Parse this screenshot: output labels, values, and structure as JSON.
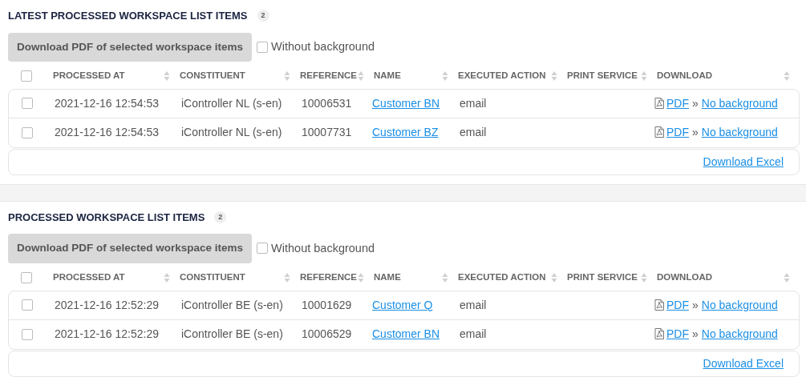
{
  "sections": [
    {
      "title": "LATEST PROCESSED WORKSPACE LIST ITEMS",
      "count": "2",
      "download_button": {
        "label": "Download PDF of selected workspace items",
        "disabled": true
      },
      "without_background": {
        "label": "Without background",
        "checked": false
      },
      "select_all": {
        "checked": false
      },
      "columns": [
        "PROCESSED AT",
        "CONSTITUENT",
        "REFERENCE",
        "NAME",
        "EXECUTED ACTION",
        "PRINT SERVICE",
        "DOWNLOAD"
      ],
      "rows": [
        {
          "checked": false,
          "processed_at": "2021-12-16 12:54:53",
          "constituent": "iController NL (s-en)",
          "reference": "10006531",
          "name": "Customer BN",
          "executed_action": "email",
          "pdf": "PDF",
          "separator": "»",
          "no_background": "No background"
        },
        {
          "checked": false,
          "processed_at": "2021-12-16 12:54:53",
          "constituent": "iController NL (s-en)",
          "reference": "10007731",
          "name": "Customer BZ",
          "executed_action": "email",
          "pdf": "PDF",
          "separator": "»",
          "no_background": "No background"
        }
      ],
      "excel_link": "Download Excel"
    },
    {
      "title": "PROCESSED WORKSPACE LIST ITEMS",
      "count": "2",
      "download_button": {
        "label": "Download PDF of selected workspace items",
        "disabled": true
      },
      "without_background": {
        "label": "Without background",
        "checked": false
      },
      "select_all": {
        "checked": false
      },
      "columns": [
        "PROCESSED AT",
        "CONSTITUENT",
        "REFERENCE",
        "NAME",
        "EXECUTED ACTION",
        "PRINT SERVICE",
        "DOWNLOAD"
      ],
      "rows": [
        {
          "checked": false,
          "processed_at": "2021-12-16 12:52:29",
          "constituent": "iController BE (s-en)",
          "reference": "10001629",
          "name": "Customer Q",
          "executed_action": "email",
          "pdf": "PDF",
          "separator": "»",
          "no_background": "No background"
        },
        {
          "checked": false,
          "processed_at": "2021-12-16 12:52:29",
          "constituent": "iController BE (s-en)",
          "reference": "10006529",
          "name": "Customer BN",
          "executed_action": "email",
          "pdf": "PDF",
          "separator": "»",
          "no_background": "No background"
        }
      ],
      "excel_link": "Download Excel"
    }
  ]
}
